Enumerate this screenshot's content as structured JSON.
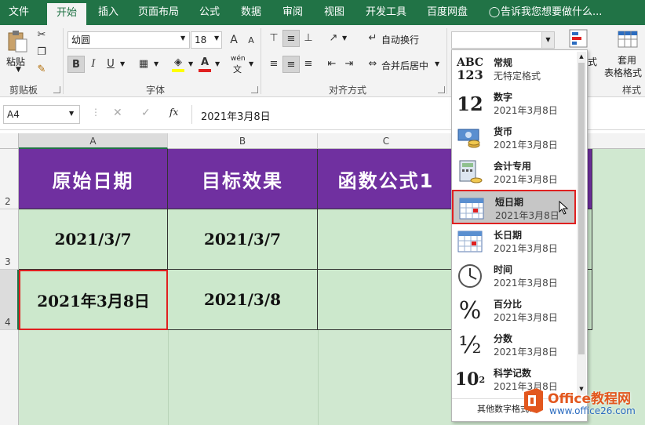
{
  "menu": {
    "tabs": [
      "文件",
      "开始",
      "插入",
      "页面布局",
      "公式",
      "数据",
      "审阅",
      "视图",
      "开发工具",
      "百度网盘"
    ],
    "active_tab": "开始",
    "tell_me": "告诉我您想要做什么..."
  },
  "ribbon": {
    "clipboard": {
      "paste": "粘贴",
      "label": "剪贴板"
    },
    "font": {
      "name": "幼圆",
      "size": "18",
      "bold": "B",
      "italic": "I",
      "underline": "U",
      "grow": "A",
      "shrink": "A",
      "label": "字体",
      "color_letter": "A",
      "phonetic_top": "wén",
      "phonetic_bottom": "文"
    },
    "alignment": {
      "wrap": "自动换行",
      "merge": "合并后居中",
      "label": "对齐方式"
    },
    "number_format_value": "",
    "styles": {
      "cond_format_fragment": "式",
      "table_format_line1": "套用",
      "table_format_line2": "表格格式",
      "label": "样式"
    }
  },
  "formula_bar": {
    "name_box": "A4",
    "fx": "fx",
    "content": "2021年3月8日"
  },
  "sheet": {
    "columns": [
      "A",
      "B",
      "C"
    ],
    "rows": [
      "2",
      "3",
      "4"
    ],
    "headers": [
      "原始日期",
      "目标效果",
      "函数公式1"
    ],
    "data": [
      [
        "2021/3/7",
        "2021/3/7",
        ""
      ],
      [
        "2021年3月8日",
        "2021/3/8",
        ""
      ]
    ]
  },
  "format_menu": {
    "items": [
      {
        "name": "常规",
        "sample": "无特定格式",
        "icon": "general-abc-icon",
        "glyph": "ABC\n123"
      },
      {
        "name": "数字",
        "sample": "2021年3月8日",
        "icon": "number-12-icon",
        "glyph": "12"
      },
      {
        "name": "货币",
        "sample": "2021年3月8日",
        "icon": "currency-icon"
      },
      {
        "name": "会计专用",
        "sample": "2021年3月8日",
        "icon": "accounting-icon"
      },
      {
        "name": "短日期",
        "sample": "2021年3月8日",
        "icon": "calendar-icon"
      },
      {
        "name": "长日期",
        "sample": "2021年3月8日",
        "icon": "calendar-icon"
      },
      {
        "name": "时间",
        "sample": "2021年3月8日",
        "icon": "clock-icon"
      },
      {
        "name": "百分比",
        "sample": "2021年3月8日",
        "icon": "percent-icon",
        "glyph": "%"
      },
      {
        "name": "分数",
        "sample": "2021年3月8日",
        "icon": "fraction-icon",
        "glyph": "½"
      },
      {
        "name": "科学记数",
        "sample": "2021年3月8日",
        "icon": "scientific-icon",
        "glyph": "10²"
      }
    ],
    "selected": "短日期",
    "more": "其他数字格式..."
  },
  "watermark": {
    "brand": "Office教程网",
    "url": "www.office26.com"
  },
  "colors": {
    "excel_green": "#217346",
    "header_purple": "#7030a0",
    "cell_green": "#cce8cc",
    "highlight_red": "#e02020"
  }
}
